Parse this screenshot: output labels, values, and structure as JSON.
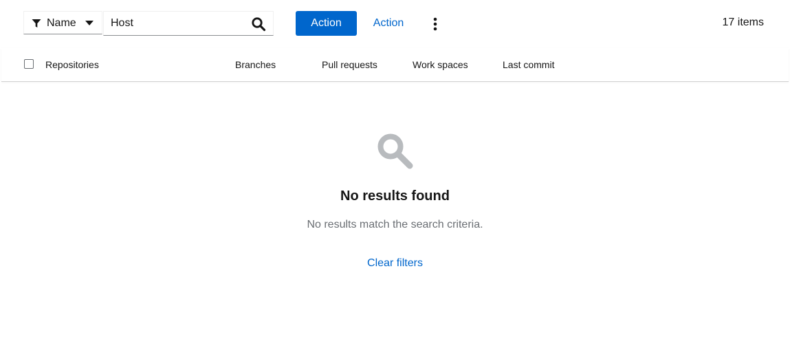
{
  "toolbar": {
    "filter_label": "Name",
    "filter_icon": "filter-icon",
    "caret_icon": "caret-down-icon",
    "search_value": "Host",
    "search_icon": "search-icon",
    "primary_action_label": "Action",
    "secondary_action_label": "Action",
    "kebab_icon": "kebab-vertical-icon",
    "item_count": "17 items"
  },
  "table": {
    "columns": [
      "Repositories",
      "Branches",
      "Pull requests",
      "Work spaces",
      "Last commit"
    ]
  },
  "empty_state": {
    "icon": "search-icon",
    "title": "No results found",
    "body": "No results match the search criteria.",
    "link_label": "Clear filters"
  },
  "colors": {
    "primary": "#0066cc",
    "text": "#151515",
    "muted": "#6a6e73",
    "icon_gray": "#b8bbbe"
  }
}
